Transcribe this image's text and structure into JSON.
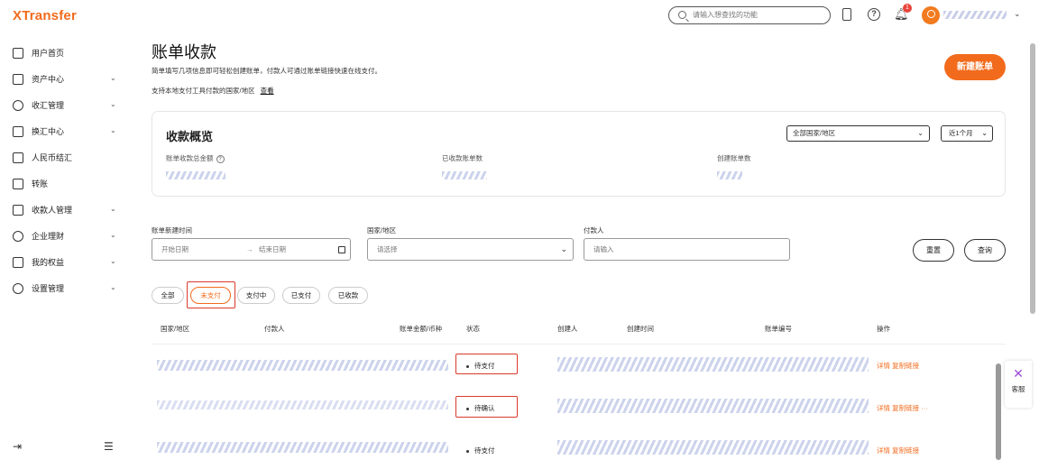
{
  "brand": {
    "name": "XTransfer"
  },
  "header": {
    "search_placeholder": "请输入想查找的功能",
    "notification_count": "1",
    "icons": [
      "search-icon",
      "phone-icon",
      "help-icon",
      "bell-icon",
      "user-icon",
      "chevron-down-icon"
    ]
  },
  "sidebar": {
    "items": [
      {
        "label": "用户首页",
        "icon": "home-icon",
        "expandable": false
      },
      {
        "label": "资产中心",
        "icon": "wallet-icon",
        "expandable": true
      },
      {
        "label": "收汇管理",
        "icon": "user-icon",
        "expandable": true
      },
      {
        "label": "换汇中心",
        "icon": "exchange-icon",
        "expandable": true
      },
      {
        "label": "人民币结汇",
        "icon": "rmb-icon",
        "expandable": false
      },
      {
        "label": "转账",
        "icon": "transfer-icon",
        "expandable": false
      },
      {
        "label": "收款人管理",
        "icon": "payee-icon",
        "expandable": true
      },
      {
        "label": "企业理财",
        "icon": "shield-icon",
        "expandable": true
      },
      {
        "label": "我的权益",
        "icon": "gift-icon",
        "expandable": true
      },
      {
        "label": "设置管理",
        "icon": "gear-icon",
        "expandable": true
      }
    ],
    "footer_icons": [
      "collapse-icon",
      "list-icon"
    ]
  },
  "page": {
    "title": "账单收款",
    "subtitle": "简单填写几项信息即可轻松创建账单，付款人可通过账单链接快速在线支付。",
    "local_methods_text": "支持本地支付工具付款的国家/地区",
    "local_methods_link": "查看",
    "new_bill_button": "新建账单"
  },
  "overview": {
    "title": "收款概览",
    "country_select": "全部国家/地区",
    "range_select": "近1个月",
    "metrics": [
      {
        "label": "账单收款总金额"
      },
      {
        "label": "已收款账单数"
      },
      {
        "label": "创建账单数"
      }
    ]
  },
  "filters": {
    "created_time_label": "账单新建时间",
    "start_placeholder": "开始日期",
    "range_arrow": "→",
    "end_placeholder": "结束日期",
    "country_label": "国家/地区",
    "country_placeholder": "请选择",
    "payer_label": "付款人",
    "payer_placeholder": "请输入",
    "reset_button": "重置",
    "query_button": "查询"
  },
  "status_tabs": [
    {
      "label": "全部",
      "active": false
    },
    {
      "label": "未支付",
      "active": true
    },
    {
      "label": "支付中",
      "active": false
    },
    {
      "label": "已支付",
      "active": false
    },
    {
      "label": "已收款",
      "active": false
    }
  ],
  "table": {
    "columns": [
      "国家/地区",
      "付款人",
      "账单金额/币种",
      "状态",
      "创建人",
      "创建时间",
      "账单编号",
      "操作"
    ],
    "rows": [
      {
        "status": "待支付",
        "actions": [
          "详情",
          "复制链接"
        ],
        "more": ""
      },
      {
        "status": "待确认",
        "actions": [
          "详情",
          "复制链接"
        ],
        "more": "···"
      },
      {
        "status": "待支付",
        "actions": [
          "详情",
          "复制链接"
        ],
        "more": ""
      }
    ]
  },
  "support": {
    "label": "客服"
  },
  "colors": {
    "accent": "#f26b1d",
    "highlight": "#d93a2b",
    "badge": "#e8443a"
  }
}
